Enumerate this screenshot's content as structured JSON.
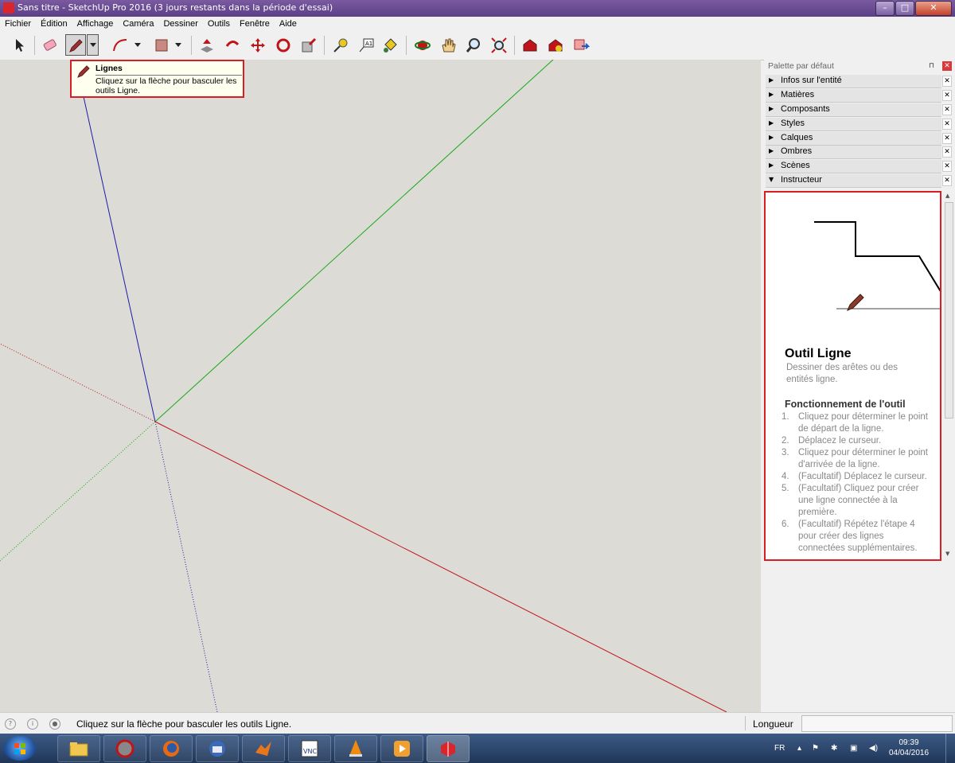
{
  "window": {
    "title": "Sans titre - SketchUp Pro 2016 (3 jours restants dans la période d'essai)"
  },
  "menu": [
    "Fichier",
    "Édition",
    "Affichage",
    "Caméra",
    "Dessiner",
    "Outils",
    "Fenêtre",
    "Aide"
  ],
  "toolbar": {
    "active_tool": "line-tool"
  },
  "tooltip": {
    "title": "Lignes",
    "description": "Cliquez sur la flèche pour basculer les outils Ligne."
  },
  "tray": {
    "title": "Palette par défaut",
    "panels": [
      "Infos sur l'entité",
      "Matières",
      "Composants",
      "Styles",
      "Calques",
      "Ombres",
      "Scènes",
      "Instructeur"
    ],
    "expanded_panel": "Instructeur"
  },
  "instructor": {
    "title": "Outil Ligne",
    "subtitle": "Dessiner des arêtes ou des entités ligne.",
    "howto_title": "Fonctionnement de l'outil",
    "steps": [
      {
        "num": "1.",
        "text": "Cliquez pour déterminer le point de départ de la ligne."
      },
      {
        "num": "2.",
        "text": "Déplacez le curseur."
      },
      {
        "num": "3.",
        "text": "Cliquez pour déterminer le point d'arrivée de la ligne."
      },
      {
        "num": "4.",
        "text": "(Facultatif) Déplacez le curseur."
      },
      {
        "num": "5.",
        "text": "(Facultatif) Cliquez pour créer une ligne connectée à la première."
      },
      {
        "num": "6.",
        "text": "(Facultatif) Répétez l'étape 4 pour créer des lignes connectées supplémentaires."
      }
    ]
  },
  "status": {
    "message": "Cliquez sur la flèche pour basculer les outils Ligne.",
    "measure_label": "Longueur",
    "measure_value": ""
  },
  "taskbar": {
    "language": "FR",
    "time": "09:39",
    "date": "04/04/2016"
  },
  "colors": {
    "axis_red": "#c0141a",
    "axis_green": "#18a818",
    "axis_blue": "#1c1ca8",
    "highlight": "#d81d24",
    "viewport_bg": "#dcdbd6"
  }
}
